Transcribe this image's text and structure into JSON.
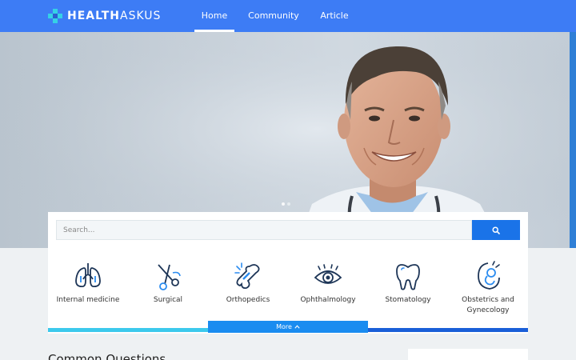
{
  "header": {
    "logo_strong": "HEALTH",
    "logo_light": "ASKUS",
    "nav": [
      {
        "label": "Home",
        "active": true
      },
      {
        "label": "Community",
        "active": false
      },
      {
        "label": "Article",
        "active": false
      }
    ]
  },
  "hero": {
    "slide_count": 2,
    "active_slide": 1
  },
  "search": {
    "placeholder": "Search...",
    "button_icon": "search-icon"
  },
  "categories": [
    {
      "label": "Internal medicine",
      "icon": "lungs-icon"
    },
    {
      "label": "Surgical",
      "icon": "surgical-scissors-icon"
    },
    {
      "label": "Orthopedics",
      "icon": "bone-icon"
    },
    {
      "label": "Ophthalmology",
      "icon": "eye-icon"
    },
    {
      "label": "Stomatology",
      "icon": "tooth-icon"
    },
    {
      "label": "Obstetrics and Gynecology",
      "icon": "fetus-icon"
    }
  ],
  "more": {
    "label": "More",
    "icon": "chevron-up-icon"
  },
  "main": {
    "section_title": "Common Questions"
  },
  "colors": {
    "brand": "#3d7cf5",
    "accent": "#1a73e8",
    "logo_cross": "#35d1e6",
    "icon_dark": "#1d3557",
    "icon_accent": "#2b8cf0"
  }
}
